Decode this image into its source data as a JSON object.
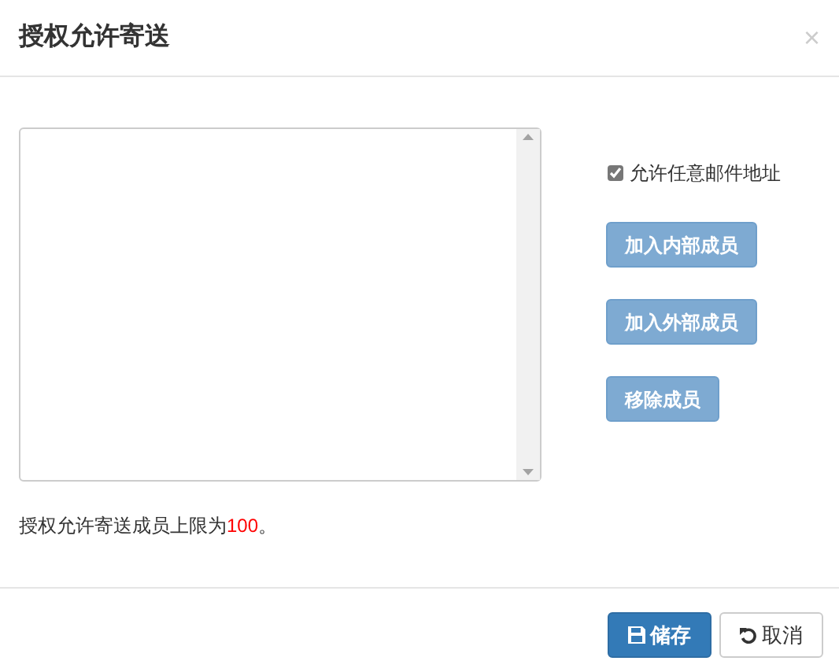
{
  "dialog": {
    "title": "授权允许寄送",
    "close": "×"
  },
  "allow_any": {
    "label": "允许任意邮件地址",
    "checked": true
  },
  "buttons": [
    {
      "label": "加入内部成员",
      "disabled": true
    },
    {
      "label": "加入外部成员",
      "disabled": true
    },
    {
      "label": "移除成员",
      "disabled": true
    }
  ],
  "note": [
    {
      "text": "授权允许寄送成员上限为",
      "kind": "plain"
    },
    {
      "text": "100",
      "kind": "highlight"
    },
    {
      "text": "。",
      "kind": "plain"
    }
  ],
  "footer": [
    {
      "label": "储存",
      "kind": "primary"
    },
    {
      "label": "取消",
      "kind": "default"
    }
  ]
}
